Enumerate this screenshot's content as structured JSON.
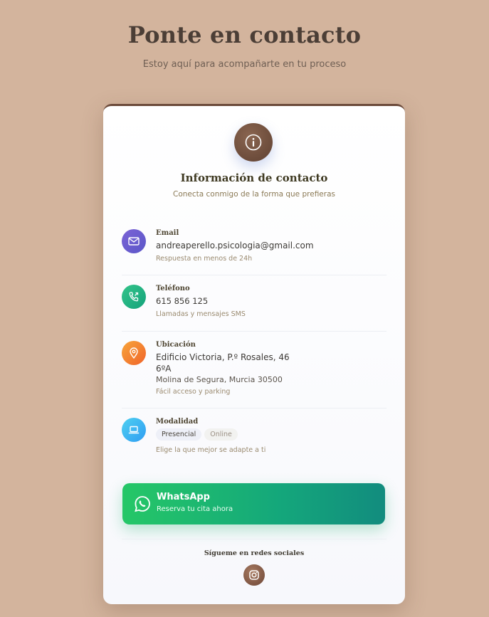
{
  "header": {
    "title": "Ponte en contacto",
    "subtitle": "Estoy aquí para acompañarte en tu proceso"
  },
  "card": {
    "icon": "info-icon",
    "title": "Información de contacto",
    "subtitle": "Conecta conmigo de la forma que prefieras"
  },
  "items": [
    {
      "icon": "email-icon",
      "label": "Email",
      "value": "andreaperello.psicologia@gmail.com",
      "note": "Respuesta en menos de 24h",
      "color_from": "#7b63d6",
      "color_to": "#5b57c8"
    },
    {
      "icon": "phone-icon",
      "label": "Teléfono",
      "value": "615 856 125",
      "note": "Llamadas y mensajes SMS",
      "color_from": "#34c48a",
      "color_to": "#14a27b"
    },
    {
      "icon": "location-icon",
      "label": "Ubicación",
      "value_line1": "Edificio Victoria, P.º Rosales, 46",
      "value_line2": "6ºA",
      "value_line3": "Molina de Segura, Murcia 30500",
      "note": "Fácil acceso y parking",
      "color_from": "#f7a63a",
      "color_to": "#f0632a"
    },
    {
      "icon": "laptop-icon",
      "label": "Modalidad",
      "chips": [
        "Presencial",
        "Online"
      ],
      "note": "Elige la que mejor se adapte a ti",
      "color_from": "#4fd0f0",
      "color_to": "#2f9cf3"
    }
  ],
  "whatsapp": {
    "icon": "whatsapp-icon",
    "title": "WhatsApp",
    "subtitle": "Reserva tu cita ahora"
  },
  "social": {
    "title": "Sígueme en redes sociales",
    "icon": "instagram-icon"
  }
}
